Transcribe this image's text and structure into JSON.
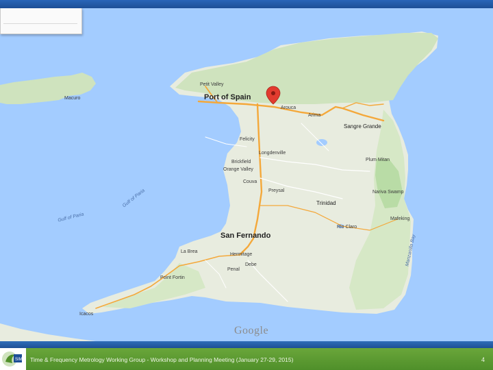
{
  "map": {
    "colors": {
      "sea": "#a3ccff",
      "land": "#e8ecdf",
      "forest": "#cfe3be",
      "road": "#f4a83a",
      "marker": "#e23b2f"
    },
    "places": {
      "port_of_spain": "Port of Spain",
      "petit_valley": "Petit Valley",
      "macuro": "Macuro",
      "arouca": "Arouca",
      "arima": "Arima",
      "sangre_grande": "Sangre Grande",
      "felicity": "Felicity",
      "longdenville": "Longdenville",
      "brickfield": "Brickfield",
      "orange_valley": "Orange Valley",
      "couva": "Couva",
      "preysal": "Preysal",
      "plum_mitan": "Plum Mitan",
      "nariva_swamp": "Nariva Swamp",
      "trinidad": "Trinidad",
      "rio_claro": "Rio Claro",
      "mafeking": "Mafeking",
      "san_fernando": "San Fernando",
      "la_brea": "La Brea",
      "hermitage": "Hermitage",
      "debe": "Debe",
      "penal": "Penal",
      "point_fortin": "Point Fortin",
      "icacos": "Icacos",
      "gulf_of_paria_1": "Gulf of Paria",
      "gulf_of_paria_2": "Gulf of Paria",
      "manzanilla_bay": "Manzanilla Bay"
    },
    "marker_icon": "map-pin-icon",
    "attribution": "Google"
  },
  "footer": {
    "text": "Time & Frequency Metrology Working Group - Workshop and Planning Meeting (January 27-29, 2015)",
    "page_number": "4",
    "logo_icon": "sim-logo-icon",
    "colors": {
      "bar": "#5b9a31",
      "strip": "#1d4f96"
    }
  }
}
